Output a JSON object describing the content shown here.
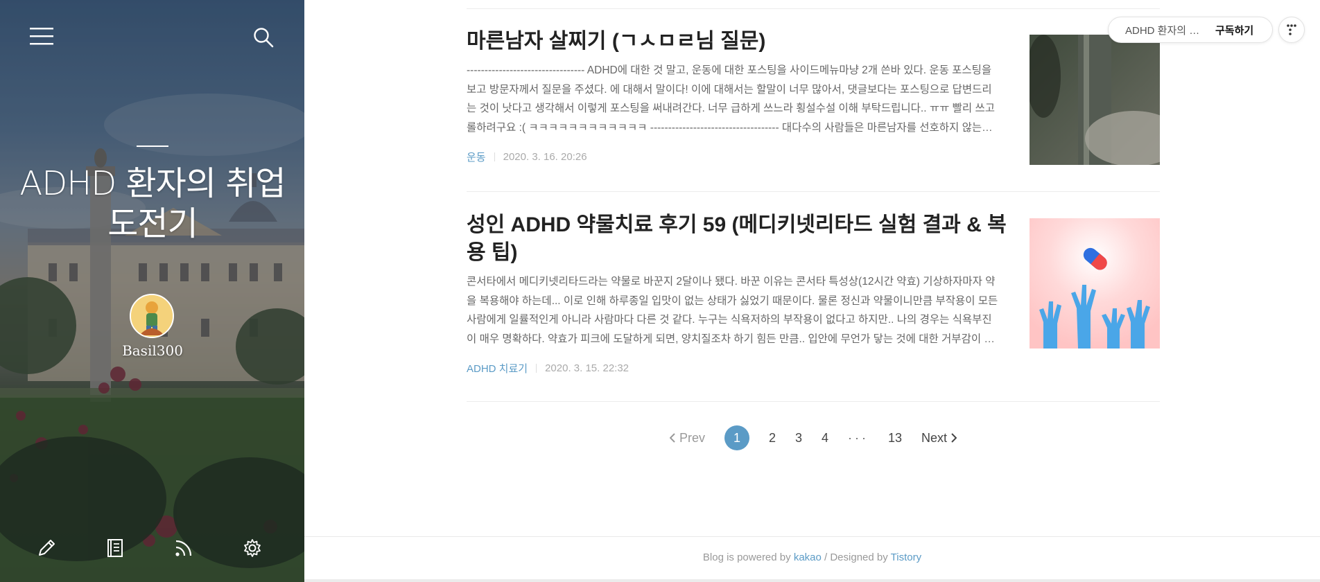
{
  "sidebar": {
    "menu_icon": "hamburger-menu-icon",
    "search_icon": "search-icon",
    "blog_title": "ADHD 환자의 취업 도전기",
    "author": "Basil300",
    "bottom_icons": [
      "write-pencil-icon",
      "notebook-icon",
      "rss-feed-icon",
      "settings-gear-icon"
    ]
  },
  "posts": [
    {
      "title": "마른남자 살찌기 (ㄱㅅㅁㄹ님 질문)",
      "excerpt": "--------------------------------- ADHD에 대한 것 말고, 운동에 대한 포스팅을 사이드메뉴마냥 2개 쓴바 있다. 운동 포스팅을 보고 방문자께서 질문을 주셨다. 에 대해서 말이다! 이에 대해서는 할말이 너무 많아서, 댓글보다는 포스팅으로 답변드리는 것이 낫다고 생각해서 이렇게 포스팅을 써내려간다. 너무 급하게 쓰느라 횡설수설 이해 부탁드립니다.. ㅠㅠ 빨리 쓰고 롤하려구요 :( ㅋㅋㅋㅋㅋㅋㅋㅋㅋㅋㅋㅋ ------------------------------------ 대다수의 사람들은 마른남자를 선호하지 않는다...",
      "category": "운동",
      "date": "2020. 3. 16. 20:26"
    },
    {
      "title": "성인 ADHD 약물치료 후기 59 (메디키넷리타드 실험 결과 & 복용 팁)",
      "excerpt": "콘서타에서 메디키넷리타드라는 약물로 바꾼지 2달이나 됐다. 바꾼 이유는 콘서타 특성상(12시간 약효) 기상하자마자 약을 복용해야 하는데... 이로 인해 하루종일 입맛이 없는 상태가 싫었기 때문이다. 물론 정신과 약물이니만큼 부작용이 모든 사람에게 일률적인게 아니라 사람마다 다른 것 같다. 누구는 식욕저하의 부작용이 없다고 하지만.. 나의 경우는 식욕부진이 매우 명확하다. 약효가 피크에 도달하게 되면, 양치질조차 하기 힘든 만큼.. 입안에 무언가 닿는 것에 대한 거부감이 생긴다...",
      "category": "ADHD 치료기",
      "date": "2020. 3. 15. 22:32"
    }
  ],
  "pagination": {
    "prev": "Prev",
    "pages": [
      "1",
      "2",
      "3",
      "4"
    ],
    "ellipsis": "···",
    "last": "13",
    "next": "Next",
    "current": "1"
  },
  "footer": {
    "prefix": "Blog is powered by",
    "kakao": "kakao",
    "middle": "/ Designed by",
    "tistory": "Tistory"
  },
  "subscribe": {
    "blog_name": "ADHD 환자의 취…",
    "button": "구독하기",
    "more_icon": "more-dots-icon"
  },
  "colors": {
    "accent": "#5b9bc6",
    "title": "#222222",
    "excerpt": "#666666",
    "muted": "#aaaaaa"
  }
}
